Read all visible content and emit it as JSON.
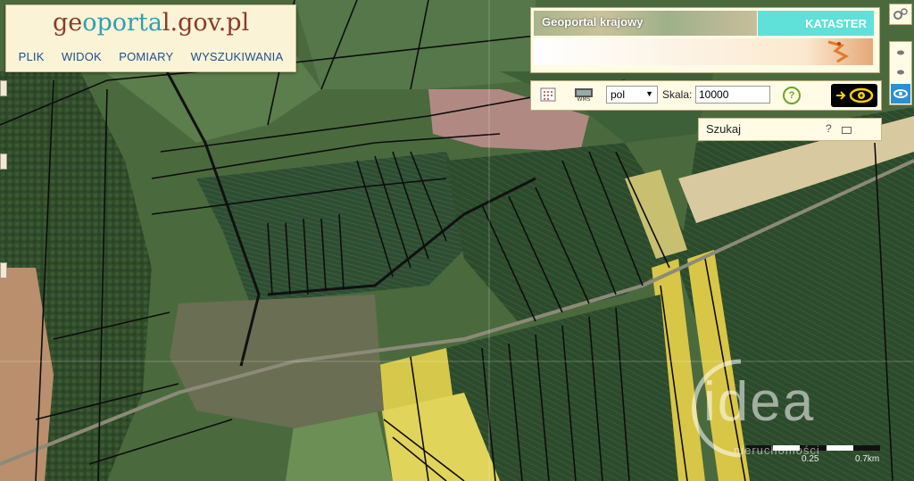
{
  "header": {
    "logo_text": "geoportal.gov.pl",
    "menu": [
      "PLIK",
      "WIDOK",
      "POMIARY",
      "WYSZUKIWANIA"
    ]
  },
  "overview": {
    "title": "Geoportal krajowy",
    "layer": "KATASTER"
  },
  "toolbar": {
    "crs_value": "pol",
    "scale_label": "Skala:",
    "scale_value": "10000",
    "help_symbol": "?"
  },
  "search": {
    "label": "Szukaj",
    "help_symbol": "?"
  },
  "scalebar": {
    "label_left": "0.25",
    "label_right": "0.7km"
  },
  "watermark": {
    "word": "idea",
    "subtitle": "nieruchomości"
  },
  "colors": {
    "panel_bg": "#fffbe4",
    "logo_brown": "#8a3b2a",
    "logo_teal": "#2f9fb3",
    "menu_blue": "#1d4e8f",
    "kataster_bg": "#5fe0d8",
    "eye_yellow": "#ffd400"
  },
  "icons": [
    "grid-icon",
    "wms-icon",
    "eye-icon",
    "arrow-right-icon",
    "help-icon",
    "minimize-icon",
    "close-icon",
    "layers-icon"
  ]
}
